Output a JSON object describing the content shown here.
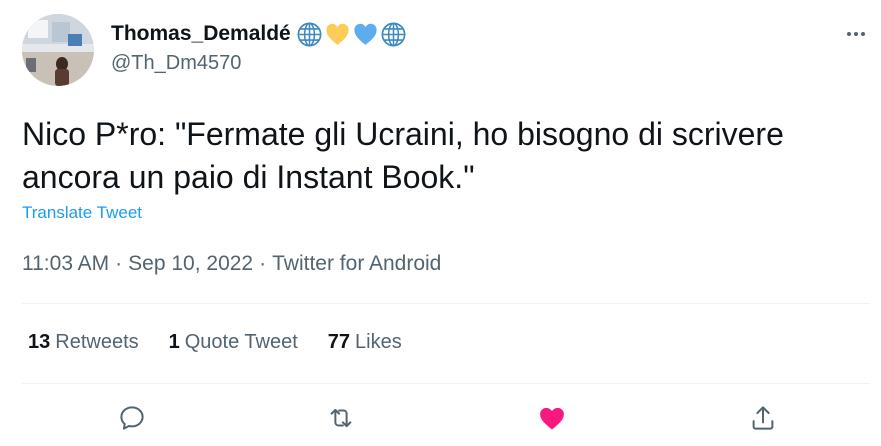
{
  "user": {
    "display_name": "Thomas_Demaldé",
    "handle": "@Th_Dm4570",
    "avatar": "avatar-photo",
    "name_emojis": [
      "globe-icon",
      "yellow-heart-icon",
      "blue-heart-icon",
      "globe-icon"
    ]
  },
  "tweet": {
    "text": "Nico P*ro: \"Fermate gli Ucraini, ho bisogno di scrivere ancora un paio di Instant Book.\"",
    "translate_label": "Translate Tweet",
    "time": "11:03 AM",
    "date": "Sep 10, 2022",
    "separator": "·",
    "source": "Twitter for Android"
  },
  "stats": {
    "retweets": {
      "count": "13",
      "label": "Retweets"
    },
    "quote_tweets": {
      "count": "1",
      "label": "Quote Tweet"
    },
    "likes": {
      "count": "77",
      "label": "Likes"
    }
  },
  "actions": {
    "reply_icon": "reply-icon",
    "retweet_icon": "retweet-icon",
    "like_icon": "heart-filled-icon",
    "share_icon": "share-icon",
    "like_active": true
  },
  "colors": {
    "text_primary": "#0f1419",
    "text_secondary": "#536471",
    "link": "#1d9bf0",
    "like": "#f91880",
    "divider": "#eff3f4"
  }
}
